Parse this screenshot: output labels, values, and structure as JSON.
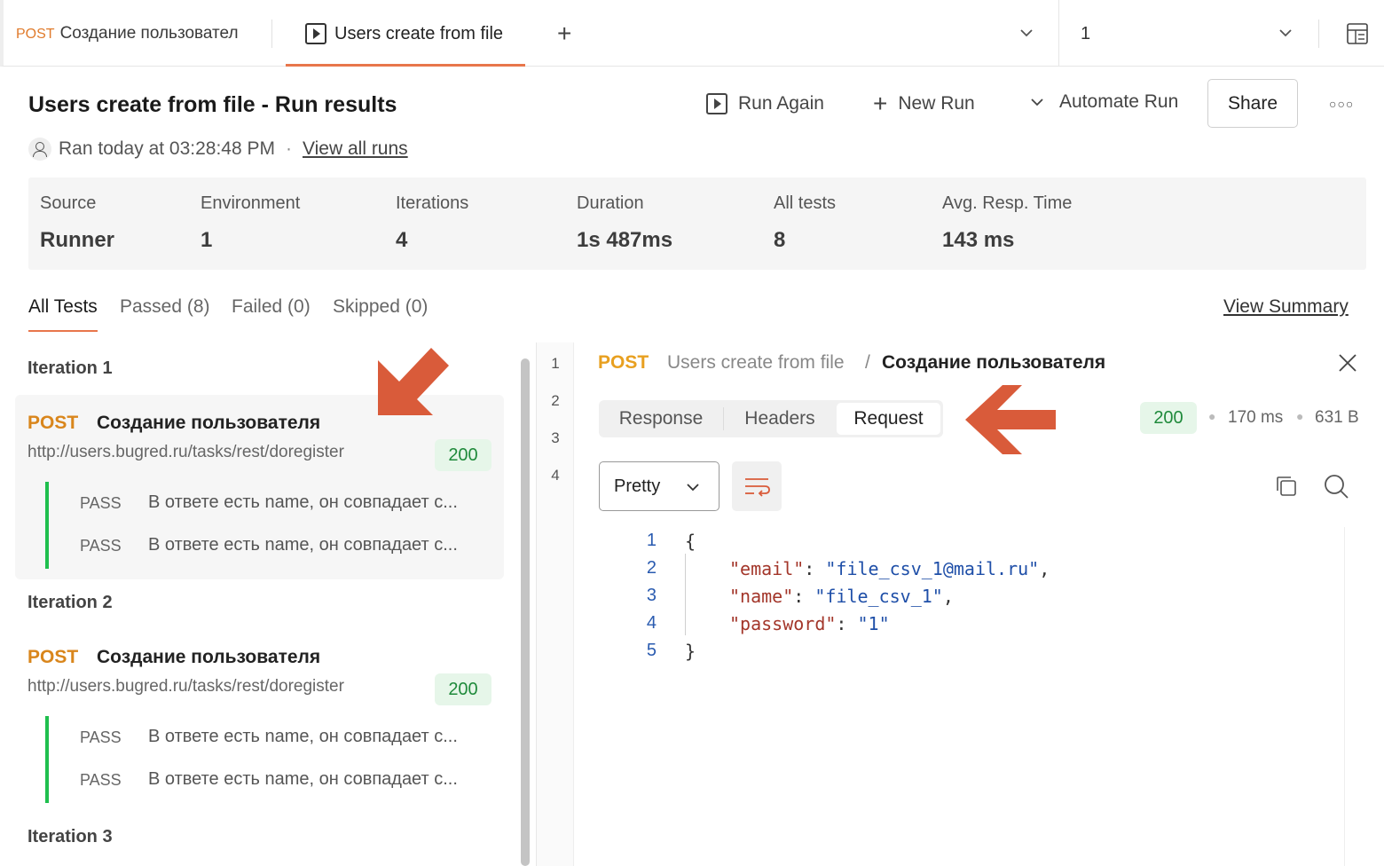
{
  "tabs": [
    {
      "method": "POST",
      "label": "Создание пользовател"
    },
    {
      "label": "Users create from file"
    }
  ],
  "environment": {
    "selected": "1"
  },
  "header": {
    "title": "Users create from file - Run results",
    "run_again": "Run Again",
    "new_run": "New Run",
    "automate_run": "Automate Run",
    "share": "Share",
    "ran_text": "Ran today at 03:28:48 PM",
    "view_all_runs": "View all runs"
  },
  "stats": [
    {
      "label": "Source",
      "value": "Runner"
    },
    {
      "label": "Environment",
      "value": "1"
    },
    {
      "label": "Iterations",
      "value": "4"
    },
    {
      "label": "Duration",
      "value": "1s 487ms"
    },
    {
      "label": "All tests",
      "value": "8"
    },
    {
      "label": "Avg. Resp. Time",
      "value": "143 ms"
    }
  ],
  "filters": {
    "all": "All Tests",
    "passed": "Passed (8)",
    "failed": "Failed (0)",
    "skipped": "Skipped (0)",
    "view_summary": "View Summary"
  },
  "iterations": [
    {
      "title": "Iteration 1",
      "method": "POST",
      "name": "Создание пользователя",
      "url": "http://users.bugred.ru/tasks/rest/doregister",
      "code": "200",
      "tests": [
        {
          "status": "PASS",
          "text": "В ответе есть name, он совпадает с..."
        },
        {
          "status": "PASS",
          "text": "В ответе есть name, он совпадает с..."
        }
      ]
    },
    {
      "title": "Iteration 2",
      "method": "POST",
      "name": "Создание пользователя",
      "url": "http://users.bugred.ru/tasks/rest/doregister",
      "code": "200",
      "tests": [
        {
          "status": "PASS",
          "text": "В ответе есть name, он совпадает с..."
        },
        {
          "status": "PASS",
          "text": "В ответе есть name, он совпадает с..."
        }
      ]
    },
    {
      "title": "Iteration 3"
    }
  ],
  "iteration_numbers": [
    "1",
    "2",
    "3",
    "4"
  ],
  "detail": {
    "method": "POST",
    "collection": "Users create from file",
    "separator": "/",
    "request_name": "Создание пользователя",
    "tabs": {
      "response": "Response",
      "headers": "Headers",
      "request": "Request"
    },
    "status_code": "200",
    "time": "170 ms",
    "size": "631 B",
    "format": "Pretty",
    "code_lines": [
      {
        "n": "1",
        "open": "{"
      },
      {
        "n": "2",
        "key": "\"email\"",
        "sep": ": ",
        "val": "\"file_csv_1@mail.ru\"",
        "end": ","
      },
      {
        "n": "3",
        "key": "\"name\"",
        "sep": ": ",
        "val": "\"file_csv_1\"",
        "end": ","
      },
      {
        "n": "4",
        "key": "\"password\"",
        "sep": ": ",
        "val": "\"1\"",
        "end": ""
      },
      {
        "n": "5",
        "open": "}"
      }
    ]
  },
  "colors": {
    "accent": "#e8764b",
    "post": "#d9861c",
    "success": "#1f8a3b",
    "pass_bar": "#1fbf4e",
    "arrow": "#d95b3a"
  }
}
